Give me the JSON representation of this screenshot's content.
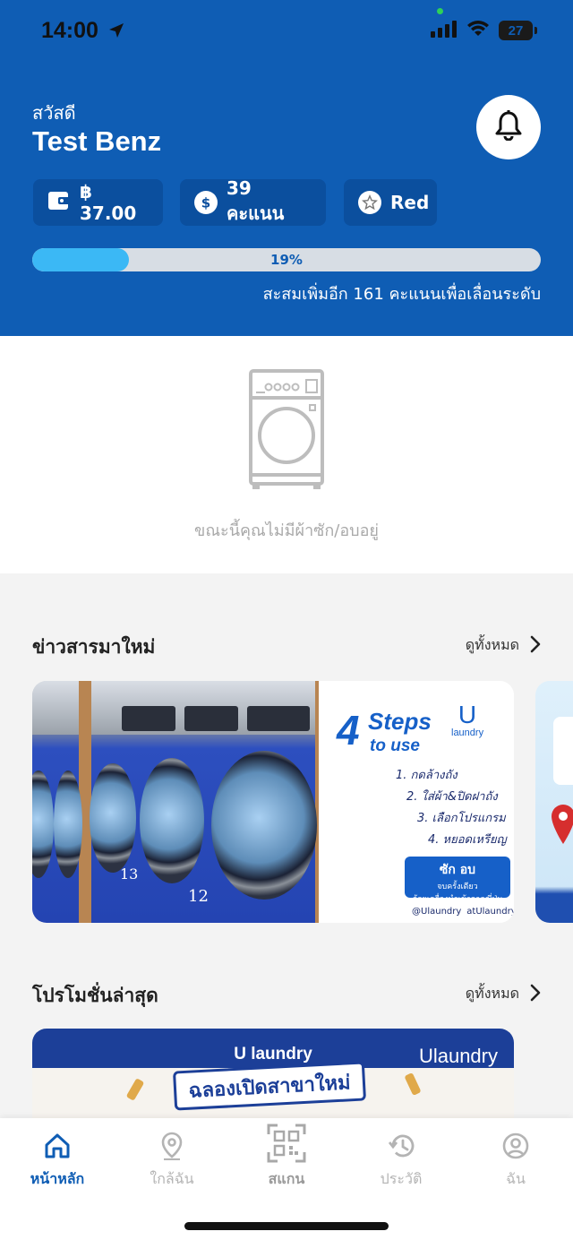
{
  "status_bar": {
    "time": "14:00",
    "battery": "27"
  },
  "header": {
    "greeting": "สวัสดี",
    "user_name": "Test Benz",
    "wallet": "฿ 37.00",
    "points": "39 คะแนน",
    "tier": "Red",
    "progress_percent": 19,
    "progress_label": "19%",
    "progress_note": "สะสมเพิ่มอีก 161 คะแนนเพื่อเลื่อนระดับ"
  },
  "laundry_status": {
    "empty_text": "ขณะนี้คุณไม่มีผ้าซัก/อบอยู่"
  },
  "news": {
    "title": "ข่าวสารมาใหม่",
    "see_all": "ดูทั้งหมด",
    "card": {
      "headline_number": "4",
      "headline_word": "Steps",
      "headline_sub": "to use",
      "brand_u": "U",
      "brand_word": "laundry",
      "steps": [
        "1. กดล้างถัง",
        "2. ใส่ผ้า&ปิดฝาถัง",
        "3. เลือกโปรแกรม",
        "4. หยอดเหรียญ"
      ],
      "badge_title": "ซัก อบ",
      "badge_sub1": "จบครั้งเดียว",
      "badge_sub2": "ด้วยเครื่องนำเข้าจากญี่ปุ่น",
      "line_handle": "@Ulaundry",
      "fb_handle": "atUlaundry",
      "machine_labels": [
        "13",
        "12"
      ]
    }
  },
  "promotions": {
    "title": "โปรโมชั่นล่าสุด",
    "see_all": "ดูทั้งหมด",
    "card": {
      "title": "U laundry",
      "brand": "Ulaundry",
      "ribbon": "ฉลองเปิดสาขาใหม่"
    }
  },
  "bottom_nav": [
    {
      "label": "หน้าหลัก",
      "icon": "home-icon",
      "active": true
    },
    {
      "label": "ใกล้ฉัน",
      "icon": "location-pin-icon",
      "active": false
    },
    {
      "label": "สแกน",
      "icon": "qr-scan-icon",
      "active": false
    },
    {
      "label": "ประวัติ",
      "icon": "history-icon",
      "active": false
    },
    {
      "label": "ฉัน",
      "icon": "profile-icon",
      "active": false
    }
  ],
  "colors": {
    "primary": "#0f5db4",
    "progress": "#3bb8f5",
    "muted": "#b4b4b4"
  }
}
